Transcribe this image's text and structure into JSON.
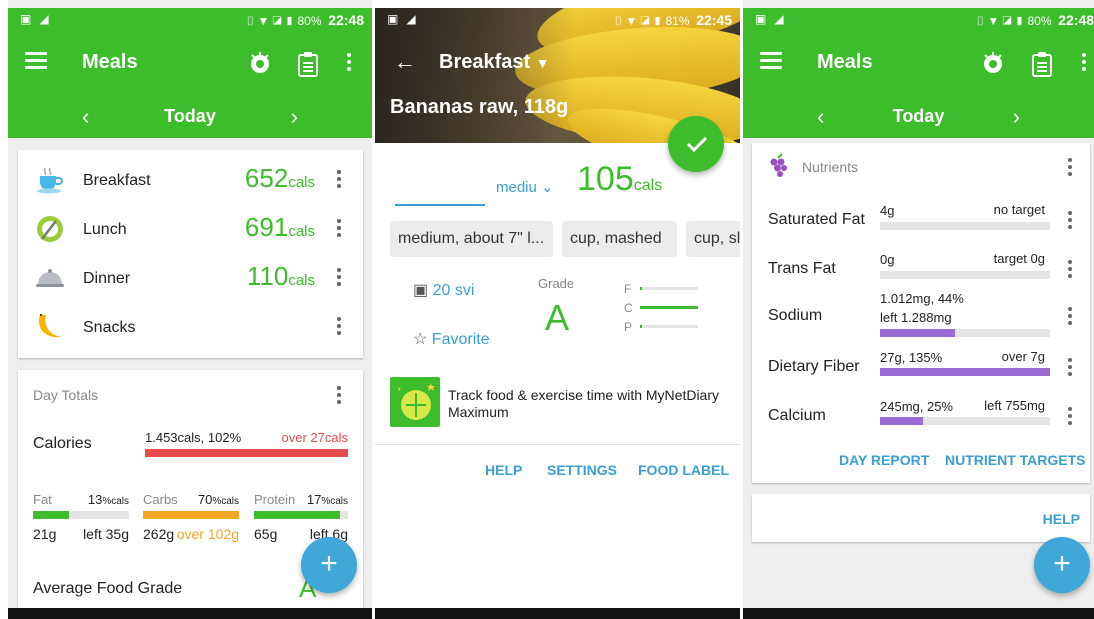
{
  "colors": {
    "green": "#3dbd2b",
    "blue": "#3b9ed1",
    "red": "#e84c4c",
    "orange": "#f5a623",
    "purple": "#9a6bd4",
    "fab": "#3fa8d8"
  },
  "screen1": {
    "status": {
      "battery": "80%",
      "time": "22:48"
    },
    "title": "Meals",
    "day_label": "Today",
    "meals": [
      {
        "name": "Breakfast",
        "cals": "652",
        "unit": "cals",
        "icon": "coffee-cup-icon"
      },
      {
        "name": "Lunch",
        "cals": "691",
        "unit": "cals",
        "icon": "plate-fork-icon"
      },
      {
        "name": "Dinner",
        "cals": "110",
        "unit": "cals",
        "icon": "cloche-icon"
      },
      {
        "name": "Snacks",
        "cals": "",
        "unit": "",
        "icon": "banana-icon"
      }
    ],
    "day_totals": {
      "title": "Day Totals",
      "calories_label": "Calories",
      "calories_value": "1.453cals, 102%",
      "calories_over": "over 27cals",
      "calories_progress": 1.0,
      "macros": [
        {
          "name": "Fat",
          "pct": "13",
          "pct_unit": "%cals",
          "amount": "21g",
          "note": "left 35g",
          "progress": 0.37,
          "color": "#3dbd2b"
        },
        {
          "name": "Carbs",
          "pct": "70",
          "pct_unit": "%cals",
          "amount": "262g",
          "note": "over 102g",
          "progress": 1.0,
          "color": "#f5a623"
        },
        {
          "name": "Protein",
          "pct": "17",
          "pct_unit": "%cals",
          "amount": "65g",
          "note": "left 6g",
          "progress": 0.92,
          "color": "#3dbd2b"
        }
      ],
      "avg_grade_label": "Average Food Grade",
      "avg_grade": "A"
    },
    "fab": "+"
  },
  "screen2": {
    "status": {
      "battery": "81%",
      "time": "22:45"
    },
    "meal_title": "Breakfast",
    "food_title": "Bananas raw, 118g",
    "serving_size": "mediu",
    "calories": "105",
    "calories_unit": "cals",
    "chips": [
      "medium, about 7\" l...",
      "cup, mashed",
      "cup, sli"
    ],
    "date_label": "20 svi",
    "favorite_label": "Favorite",
    "grade_label": "Grade",
    "grade": "A",
    "fcp": [
      {
        "letter": "F",
        "progress": 0.04
      },
      {
        "letter": "C",
        "progress": 1.0
      },
      {
        "letter": "P",
        "progress": 0.04
      }
    ],
    "promo": "Track food & exercise time with MyNetDiary Maximum",
    "links": [
      "HELP",
      "SETTINGS",
      "FOOD LABEL"
    ]
  },
  "screen3": {
    "status": {
      "battery": "80%",
      "time": "22:48"
    },
    "title": "Meals",
    "day_label": "Today",
    "section_title": "Nutrients",
    "nutrients": [
      {
        "name": "Saturated Fat",
        "value": "4g",
        "value2": "",
        "target": "no target",
        "progress": 0
      },
      {
        "name": "Trans Fat",
        "value": "0g",
        "value2": "",
        "target": "target 0g",
        "progress": 0
      },
      {
        "name": "Sodium",
        "value": "1.012mg, 44%",
        "value2": "left 1.288mg",
        "target": "",
        "progress": 0.44
      },
      {
        "name": "Dietary Fiber",
        "value": "27g, 135%",
        "value2": "",
        "target": "over 7g",
        "progress": 1.0
      },
      {
        "name": "Calcium",
        "value": "245mg, 25%",
        "value2": "",
        "target": "left 755mg",
        "progress": 0.25
      }
    ],
    "links": [
      "DAY REPORT",
      "NUTRIENT TARGETS"
    ],
    "help": "HELP",
    "fab": "+"
  }
}
